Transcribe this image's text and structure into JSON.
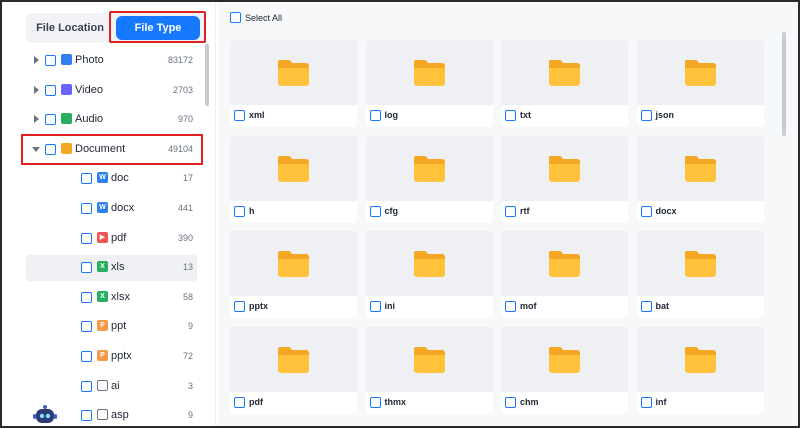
{
  "tabs": {
    "file_location": "File Location",
    "file_type": "File Type"
  },
  "tree": [
    {
      "label": "Photo",
      "count": "83172",
      "level": 0,
      "icon": "photo-icon",
      "color": "#2f80ed",
      "expanded": false
    },
    {
      "label": "Video",
      "count": "2703",
      "level": 0,
      "icon": "video-icon",
      "color": "#6c63ff",
      "expanded": false
    },
    {
      "label": "Audio",
      "count": "970",
      "level": 0,
      "icon": "audio-icon",
      "color": "#27ae60",
      "expanded": false
    },
    {
      "label": "Document",
      "count": "49104",
      "level": 0,
      "icon": "document-icon",
      "color": "#f5a623",
      "expanded": true
    },
    {
      "label": "doc",
      "count": "17",
      "level": 1,
      "icon": "word-icon",
      "color": "#2f80ed",
      "glyph": "W"
    },
    {
      "label": "docx",
      "count": "441",
      "level": 1,
      "icon": "word-icon",
      "color": "#2f80ed",
      "glyph": "W"
    },
    {
      "label": "pdf",
      "count": "390",
      "level": 1,
      "icon": "pdf-icon",
      "color": "#eb5757",
      "glyph": "▶"
    },
    {
      "label": "xls",
      "count": "13",
      "level": 1,
      "icon": "excel-icon",
      "color": "#27ae60",
      "glyph": "X",
      "selected": true
    },
    {
      "label": "xlsx",
      "count": "58",
      "level": 1,
      "icon": "excel-icon",
      "color": "#27ae60",
      "glyph": "X"
    },
    {
      "label": "ppt",
      "count": "9",
      "level": 1,
      "icon": "ppt-icon",
      "color": "#f2994a",
      "glyph": "P"
    },
    {
      "label": "pptx",
      "count": "72",
      "level": 1,
      "icon": "ppt-icon",
      "color": "#f2994a",
      "glyph": "P"
    },
    {
      "label": "ai",
      "count": "3",
      "level": 1,
      "icon": "folder-outline-icon",
      "color": "#6b7280"
    },
    {
      "label": "asp",
      "count": "9",
      "level": 1,
      "icon": "folder-outline-icon",
      "color": "#6b7280"
    }
  ],
  "select_all": "Select All",
  "files": [
    "xml",
    "log",
    "txt",
    "json",
    "h",
    "cfg",
    "rtf",
    "docx",
    "pptx",
    "ini",
    "mof",
    "bat",
    "pdf",
    "thmx",
    "chm",
    "inf"
  ],
  "colors": {
    "accent": "#1677ff",
    "highlight": "#e02020",
    "folder": "#ffc23a"
  }
}
